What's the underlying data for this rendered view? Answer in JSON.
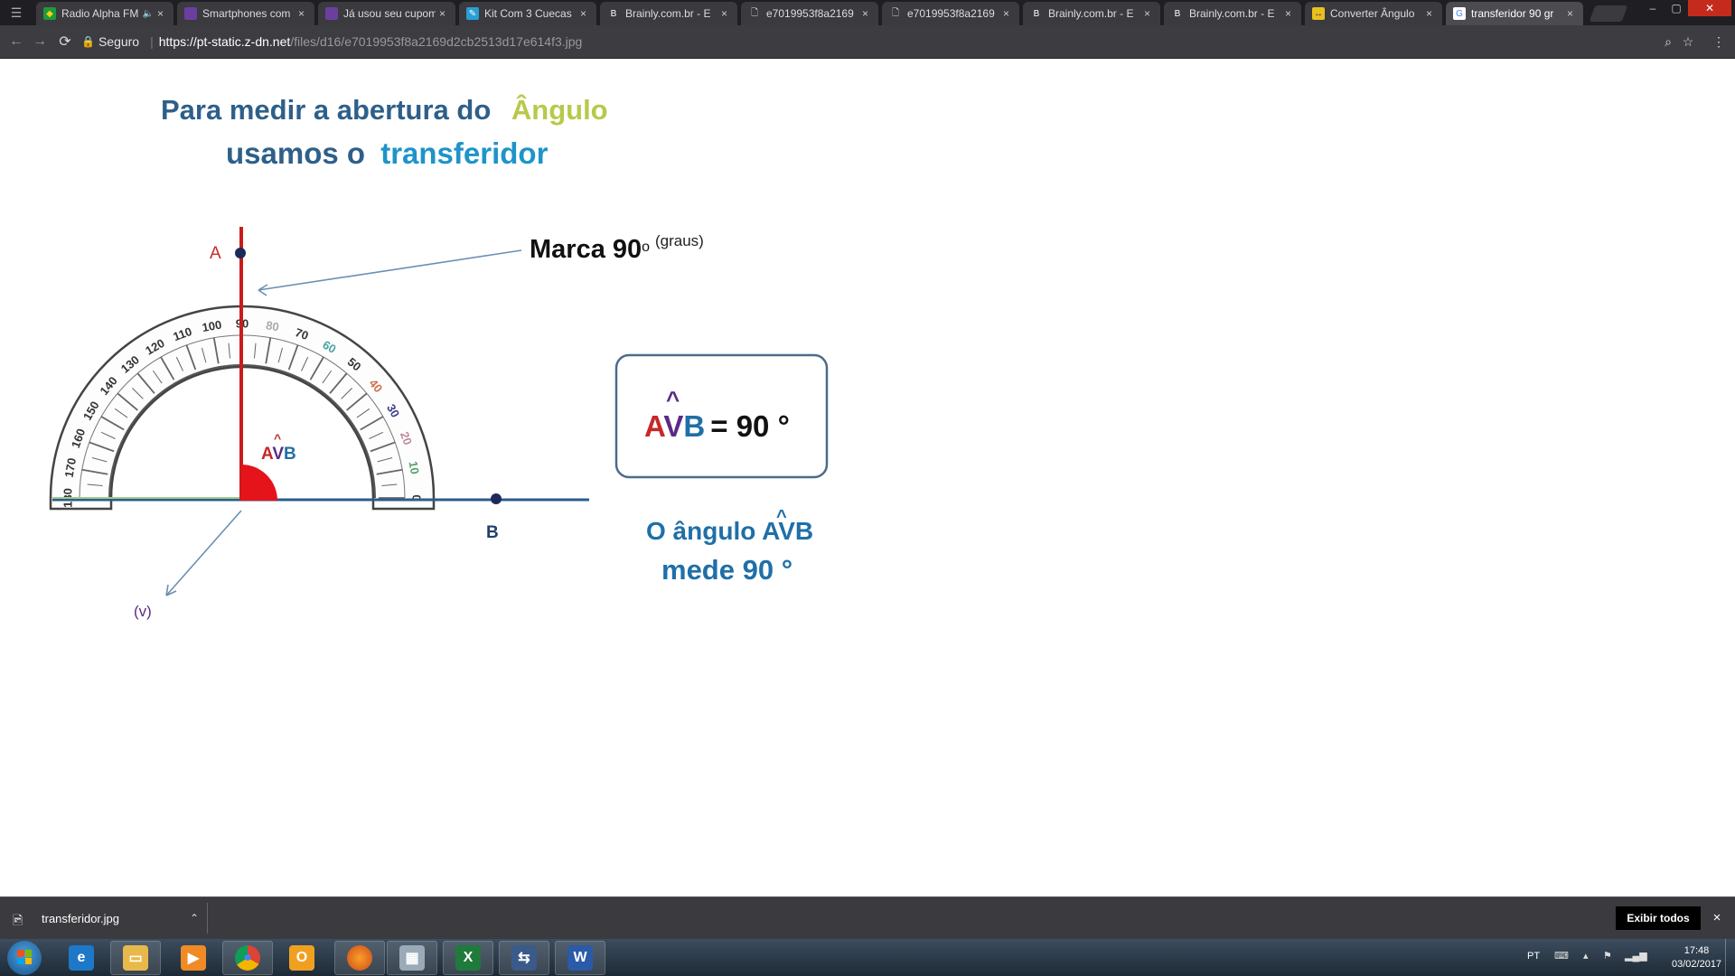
{
  "browser": {
    "tabs": [
      {
        "title": "Radio Alpha FM",
        "icon": "brazil-flag-icon",
        "audio": true
      },
      {
        "title": "Smartphones com",
        "icon": "purple-store-icon"
      },
      {
        "title": "Já usou seu cupom",
        "icon": "purple-store-icon"
      },
      {
        "title": "Kit Com 3 Cuecas",
        "icon": "shop-tag-icon"
      },
      {
        "title": "Brainly.com.br - E",
        "icon": "brainly-icon"
      },
      {
        "title": "e7019953f8a2169",
        "icon": "page-icon"
      },
      {
        "title": "e7019953f8a2169",
        "icon": "page-icon"
      },
      {
        "title": "Brainly.com.br - E",
        "icon": "brainly-icon"
      },
      {
        "title": "Brainly.com.br - E",
        "icon": "brainly-icon"
      },
      {
        "title": "Converter Ângulo",
        "icon": "converter-icon"
      },
      {
        "title": "transferidor 90 gr",
        "icon": "google-icon",
        "active": true
      }
    ],
    "close_glyph": "×",
    "address": {
      "secure_label": "Seguro",
      "host": "https://pt-static.z-dn.net",
      "path": "/files/d16/e7019953f8a2169d2cb2513d17e614f3.jpg"
    }
  },
  "figure": {
    "title_line1_a": "Para medir a abertura do",
    "title_line1_b": "Ângulo",
    "title_line2_a": "usamos o",
    "title_line2_b": "transferidor",
    "label_a": "A",
    "label_b": "B",
    "label_v": "(v)",
    "marca_text": "Marca 90",
    "marca_sup": "o",
    "marca_unit": "(graus)",
    "avb_small_a": "A",
    "avb_small_v": "V",
    "avb_small_b": "B",
    "hat": "^",
    "box_a": "A",
    "box_v": "V",
    "box_b": "B",
    "box_value": "= 90 °",
    "caption_line1": "O ângulo AVB",
    "caption_line2": "mede 90 °",
    "protractor_outer_ticks": [
      "180",
      "170",
      "160",
      "150",
      "140",
      "130",
      "120",
      "110",
      "100",
      "90",
      "80",
      "70",
      "60",
      "50",
      "40",
      "30",
      "20",
      "10",
      "0"
    ],
    "protractor_inner_ticks": [
      "0",
      "10",
      "20",
      "30",
      "40",
      "50",
      "60",
      "70",
      "80",
      "90",
      "100",
      "110",
      "120",
      "130",
      "140",
      "150",
      "160",
      "170",
      "180"
    ],
    "colors": {
      "title_blue": "#2e5f8a",
      "angulo_green": "#b8c94a",
      "transferidor_blue": "#1e94c8",
      "ray_red": "#cc1b1b",
      "label_red": "#c62828",
      "label_navy": "#1f3f6e",
      "v_purple": "#5b2a86",
      "caption_blue": "#1f6fa8"
    }
  },
  "downloads": {
    "file_name": "transferidor.jpg",
    "show_all_label": "Exibir todos",
    "close_glyph": "×"
  },
  "taskbar": {
    "apps": [
      "internet-explorer-icon",
      "file-explorer-icon",
      "media-player-icon",
      "chrome-icon",
      "outlook-icon",
      "firefox-icon",
      "calculator-icon",
      "excel-icon",
      "network-tool-icon",
      "word-icon"
    ],
    "lang": "PT",
    "time": "17:48",
    "date": "03/02/2017"
  }
}
